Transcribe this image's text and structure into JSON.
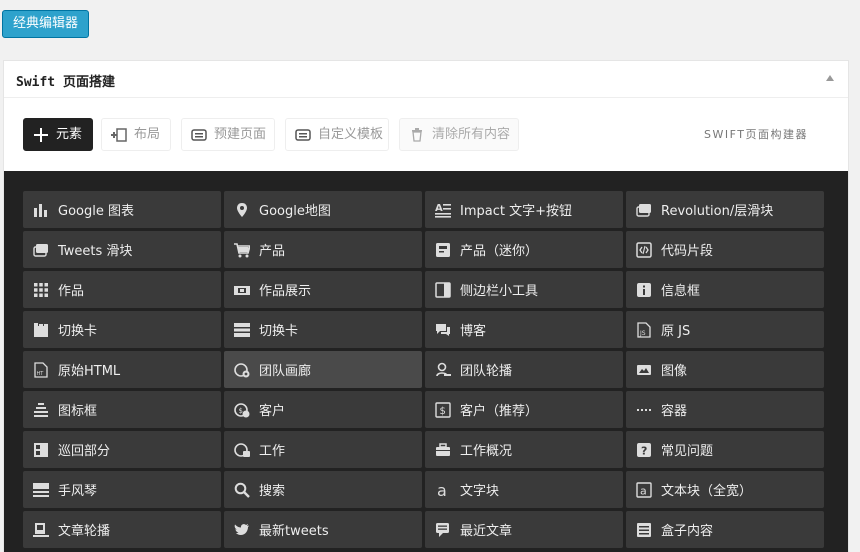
{
  "classic_editor_label": "经典编辑器",
  "panel": {
    "title": "Swift 页面搭建"
  },
  "toolbar": {
    "elements_label": "元素",
    "layout_label": "布局",
    "prebuilt_label": "预建页面",
    "custom_template_label": "自定义模板",
    "clear_all_label": "清除所有内容",
    "brand": "SWIFT页面构建器"
  },
  "elements": [
    {
      "label": "Google 图表",
      "icon": "bar-chart-icon"
    },
    {
      "label": "Google地图",
      "icon": "map-marker-icon"
    },
    {
      "label": "Impact 文字+按钮",
      "icon": "text-align-icon"
    },
    {
      "label": "Revolution/层滑块",
      "icon": "slider-icon"
    },
    {
      "label": "Tweets 滑块",
      "icon": "tweets-slider-icon"
    },
    {
      "label": "产品",
      "icon": "cart-icon"
    },
    {
      "label": "产品（迷你）",
      "icon": "mini-product-icon"
    },
    {
      "label": "代码片段",
      "icon": "code-icon"
    },
    {
      "label": "作品",
      "icon": "grid-icon"
    },
    {
      "label": "作品展示",
      "icon": "showcase-icon"
    },
    {
      "label": "侧边栏小工具",
      "icon": "sidebar-icon"
    },
    {
      "label": "信息框",
      "icon": "info-icon"
    },
    {
      "label": "切换卡",
      "icon": "tabs-icon"
    },
    {
      "label": "切换卡",
      "icon": "toggle-list-icon"
    },
    {
      "label": "博客",
      "icon": "comments-icon"
    },
    {
      "label": "原 JS",
      "icon": "js-file-icon"
    },
    {
      "label": "原始HTML",
      "icon": "html-file-icon"
    },
    {
      "label": "团队画廊",
      "icon": "team-gallery-icon"
    },
    {
      "label": "团队轮播",
      "icon": "team-carousel-icon"
    },
    {
      "label": "图像",
      "icon": "image-icon"
    },
    {
      "label": "图标框",
      "icon": "icon-box-icon"
    },
    {
      "label": "客户",
      "icon": "clients-icon"
    },
    {
      "label": "客户（推荐）",
      "icon": "testimonial-icon"
    },
    {
      "label": "容器",
      "icon": "ellipsis-icon"
    },
    {
      "label": "巡回部分",
      "icon": "section-icon"
    },
    {
      "label": "工作",
      "icon": "jobs-icon"
    },
    {
      "label": "工作概况",
      "icon": "briefcase-icon"
    },
    {
      "label": "常见问题",
      "icon": "faq-icon"
    },
    {
      "label": "手风琴",
      "icon": "accordion-icon"
    },
    {
      "label": "搜索",
      "icon": "search-icon"
    },
    {
      "label": "文字块",
      "icon": "text-block-icon"
    },
    {
      "label": "文本块（全宽）",
      "icon": "text-block-full-icon"
    },
    {
      "label": "文章轮播",
      "icon": "post-carousel-icon"
    },
    {
      "label": "最新tweets",
      "icon": "twitter-icon"
    },
    {
      "label": "最近文章",
      "icon": "recent-posts-icon"
    },
    {
      "label": "盒子内容",
      "icon": "boxed-content-icon"
    }
  ]
}
